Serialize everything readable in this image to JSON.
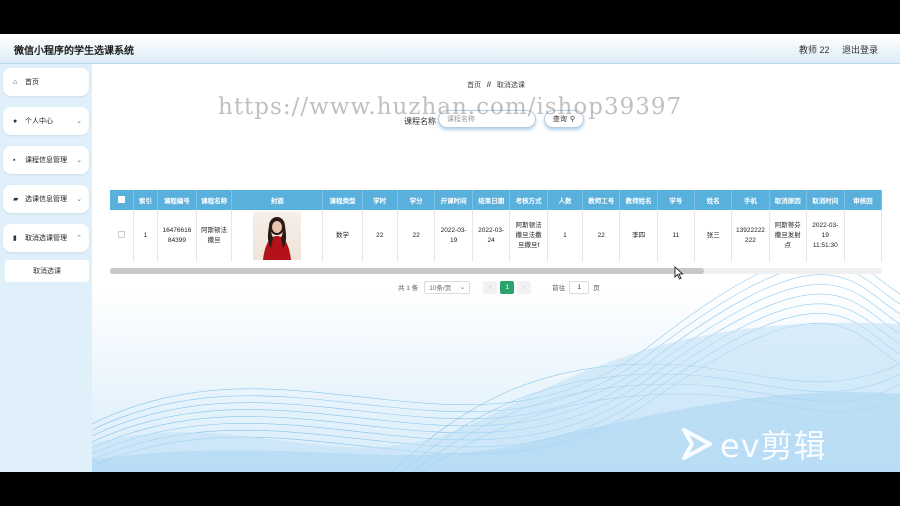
{
  "app": {
    "title": "微信小程序的学生选课系统"
  },
  "header": {
    "user": "教师 22",
    "logout": "退出登录"
  },
  "sidebar": {
    "items": [
      {
        "label": "首页",
        "icon": "home-icon",
        "glyph": "⌂"
      },
      {
        "label": "个人中心",
        "icon": "user-icon",
        "glyph": "●"
      },
      {
        "label": "课程信息管理",
        "icon": "book-icon",
        "glyph": "▪"
      },
      {
        "label": "选课信息管理",
        "icon": "folder-icon",
        "glyph": "▰"
      },
      {
        "label": "取消选课管理",
        "icon": "bar-chart-icon",
        "glyph": "▮"
      }
    ],
    "subitem": "取消选课"
  },
  "breadcrumb": {
    "home": "首页",
    "sep": "//",
    "current": "取消选课"
  },
  "search": {
    "label": "课程名称",
    "placeholder": "课程名称",
    "button": "查询"
  },
  "watermark": "https://www.huzhan.com/ishop39397",
  "table": {
    "headers": [
      "索引",
      "课程编号",
      "课程名称",
      "封面",
      "课程类型",
      "学时",
      "学分",
      "开课时间",
      "结束日期",
      "考核方式",
      "人数",
      "教师工号",
      "教师姓名",
      "学号",
      "姓名",
      "手机",
      "取消原因",
      "取消时间",
      "审核回"
    ],
    "rows": [
      {
        "index": "1",
        "course_no": "1647661684399",
        "course_name": "阿斯顿法撒旦",
        "course_type": "数学",
        "hours": "22",
        "credits": "22",
        "start": "2022-03-19",
        "end": "2022-03-24",
        "assessment": "阿斯顿法撒旦法撒旦撒旦f",
        "people": "1",
        "teacher_no": "22",
        "teacher_name": "李四",
        "student_no": "11",
        "student_name": "张三",
        "phone": "13922222222",
        "cancel_reason": "阿斯蒂芬撒旦发射点",
        "cancel_time": "2022-03-19 11:51:30",
        "review": ""
      }
    ]
  },
  "pagination": {
    "total": "共 1 条",
    "page_size": "10条/页",
    "current": "1",
    "goto_label": "前往",
    "goto_value": "1",
    "page_suffix": "页"
  },
  "brand": {
    "logo_text": "ev剪辑"
  },
  "colors": {
    "header_th": "#5ab0dc",
    "active_page": "#2ba36a",
    "sidebar_bg": "#dff0fa"
  }
}
